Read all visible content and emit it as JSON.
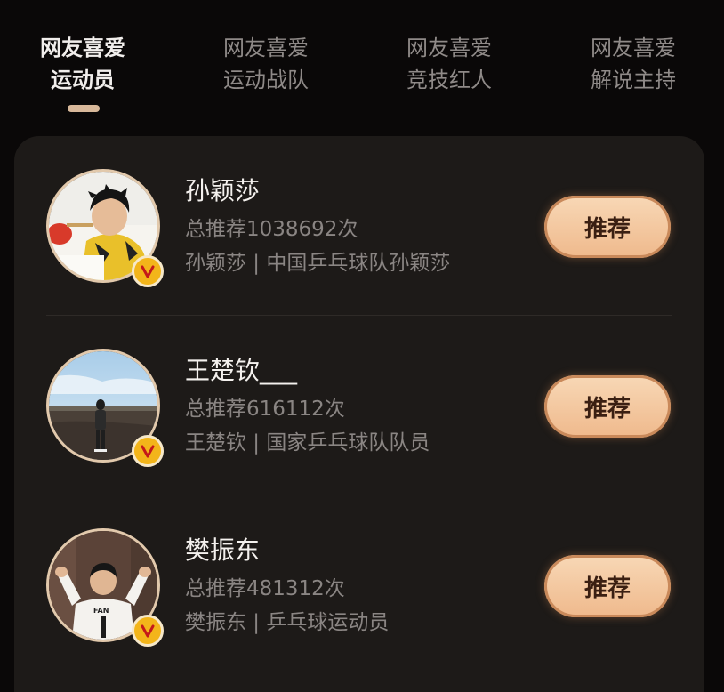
{
  "tabs": [
    {
      "line1": "网友喜爱",
      "line2": "运动员",
      "active": true
    },
    {
      "line1": "网友喜爱",
      "line2": "运动战队",
      "active": false
    },
    {
      "line1": "网友喜爱",
      "line2": "竞技红人",
      "active": false
    },
    {
      "line1": "网友喜爱",
      "line2": "解说主持",
      "active": false
    }
  ],
  "list": [
    {
      "name": "孙颖莎",
      "count": "总推荐1038692次",
      "desc": "孙颖莎 | 中国乒乓球队孙颖莎",
      "button": "推荐"
    },
    {
      "name": "王楚钦___",
      "count": "总推荐616112次",
      "desc": "王楚钦 | 国家乒乓球队队员",
      "button": "推荐"
    },
    {
      "name": "樊振东",
      "count": "总推荐481312次",
      "desc": "樊振东 | 乒乓球运动员",
      "button": "推荐"
    }
  ],
  "colors": {
    "background": "#0a0808",
    "card": "#1d1a18",
    "button": "#efb98c",
    "verified": "#f3b51a",
    "indicator": "#d8b89a"
  },
  "icons": {
    "verified": "verified-v-icon"
  }
}
